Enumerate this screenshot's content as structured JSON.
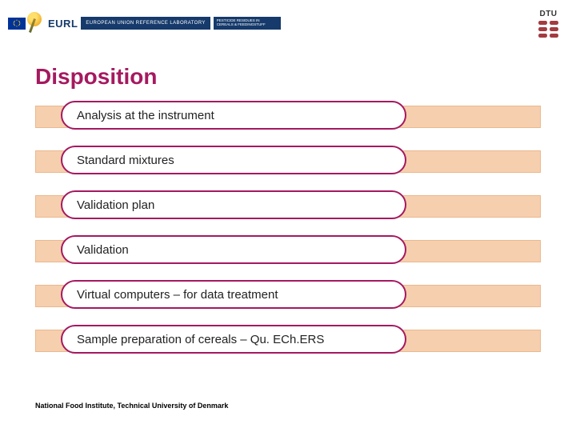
{
  "header": {
    "eurl_label": "EURL",
    "blue_bar1": "EUROPEAN UNION REFERENCE LABORATORY",
    "blue_bar2_line1": "PESTICIDE RESIDUES IN",
    "blue_bar2_line2": "CEREALS & FEEDINGSTUFF",
    "dtu_label": "DTU"
  },
  "title": "Disposition",
  "items": [
    {
      "label": "Analysis at the instrument"
    },
    {
      "label": "Standard mixtures"
    },
    {
      "label": "Validation plan"
    },
    {
      "label": "Validation"
    },
    {
      "label": "Virtual computers – for data treatment"
    },
    {
      "label": "Sample preparation of cereals – Qu. ECh.ERS"
    }
  ],
  "footer": "National Food Institute, Technical University of Denmark"
}
